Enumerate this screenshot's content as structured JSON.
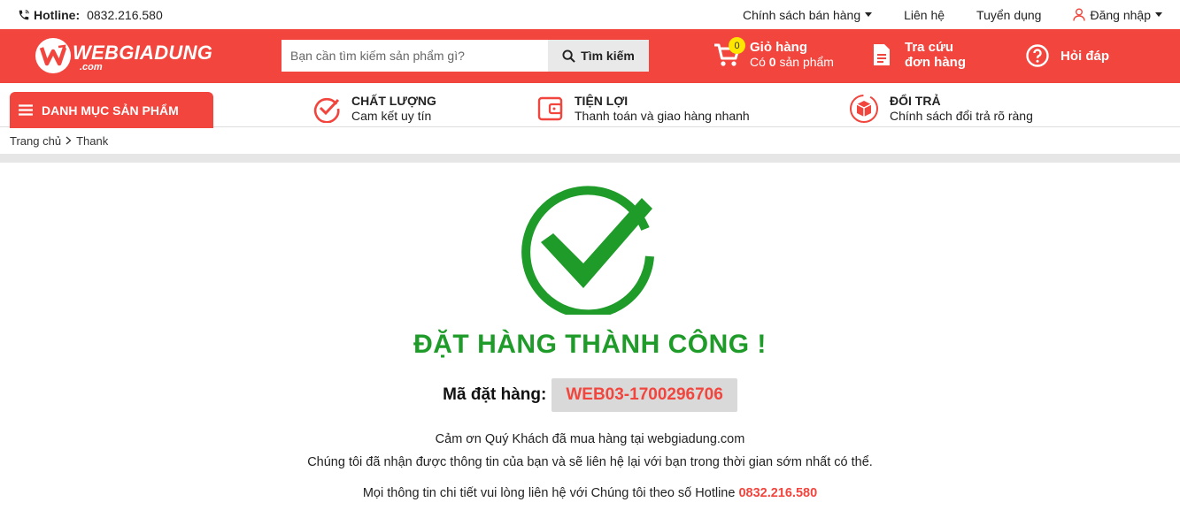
{
  "topbar": {
    "hotline_label": "Hotline:",
    "hotline_number": "0832.216.580",
    "links": [
      "Chính sách bán hàng",
      "Liên hệ",
      "Tuyển dụng"
    ],
    "login": "Đăng nhập"
  },
  "header": {
    "brand": "WEBGIADUNG",
    "brand_suffix": ".com",
    "search_placeholder": "Bạn cần tìm kiếm sản phẩm gì?",
    "search_button": "Tìm kiếm",
    "cart_title": "Giỏ hàng",
    "cart_prefix": "Có ",
    "cart_count": "0",
    "cart_suffix": " sản phẩm",
    "cart_badge": "0",
    "track_line1": "Tra cứu",
    "track_line2": "đơn hàng",
    "help": "Hỏi đáp"
  },
  "nav": {
    "category_button": "DANH MỤC SẢN PHẨM",
    "features": [
      {
        "title": "CHẤT LƯỢNG",
        "subtitle": "Cam kết uy tín",
        "icon": "check-circle-icon"
      },
      {
        "title": "TIỆN LỢI",
        "subtitle": "Thanh toán và giao hàng nhanh",
        "icon": "wallet-icon"
      },
      {
        "title": "ĐỔI TRẢ",
        "subtitle": "Chính sách đổi trả rõ ràng",
        "icon": "return-box-icon"
      }
    ]
  },
  "breadcrumb": {
    "home": "Trang chủ",
    "current": "Thank"
  },
  "main": {
    "title": "ĐẶT HÀNG THÀNH CÔNG !",
    "order_label": "Mã đặt hàng:",
    "order_code": "WEB03-1700296706",
    "thanks_line1": "Cảm ơn Quý Khách đã mua hàng tại webgiadung.com",
    "thanks_line2": "Chúng tôi đã nhận được thông tin của bạn và sẽ liên hệ lại với bạn trong thời gian sớm nhất có thể.",
    "contact_text": "Mọi thông tin chi tiết vui lòng liên hệ với Chúng tôi theo số Hotline ",
    "contact_number": "0832.216.580"
  },
  "colors": {
    "brand_red": "#f1453d",
    "success_green": "#1f9b2a"
  }
}
